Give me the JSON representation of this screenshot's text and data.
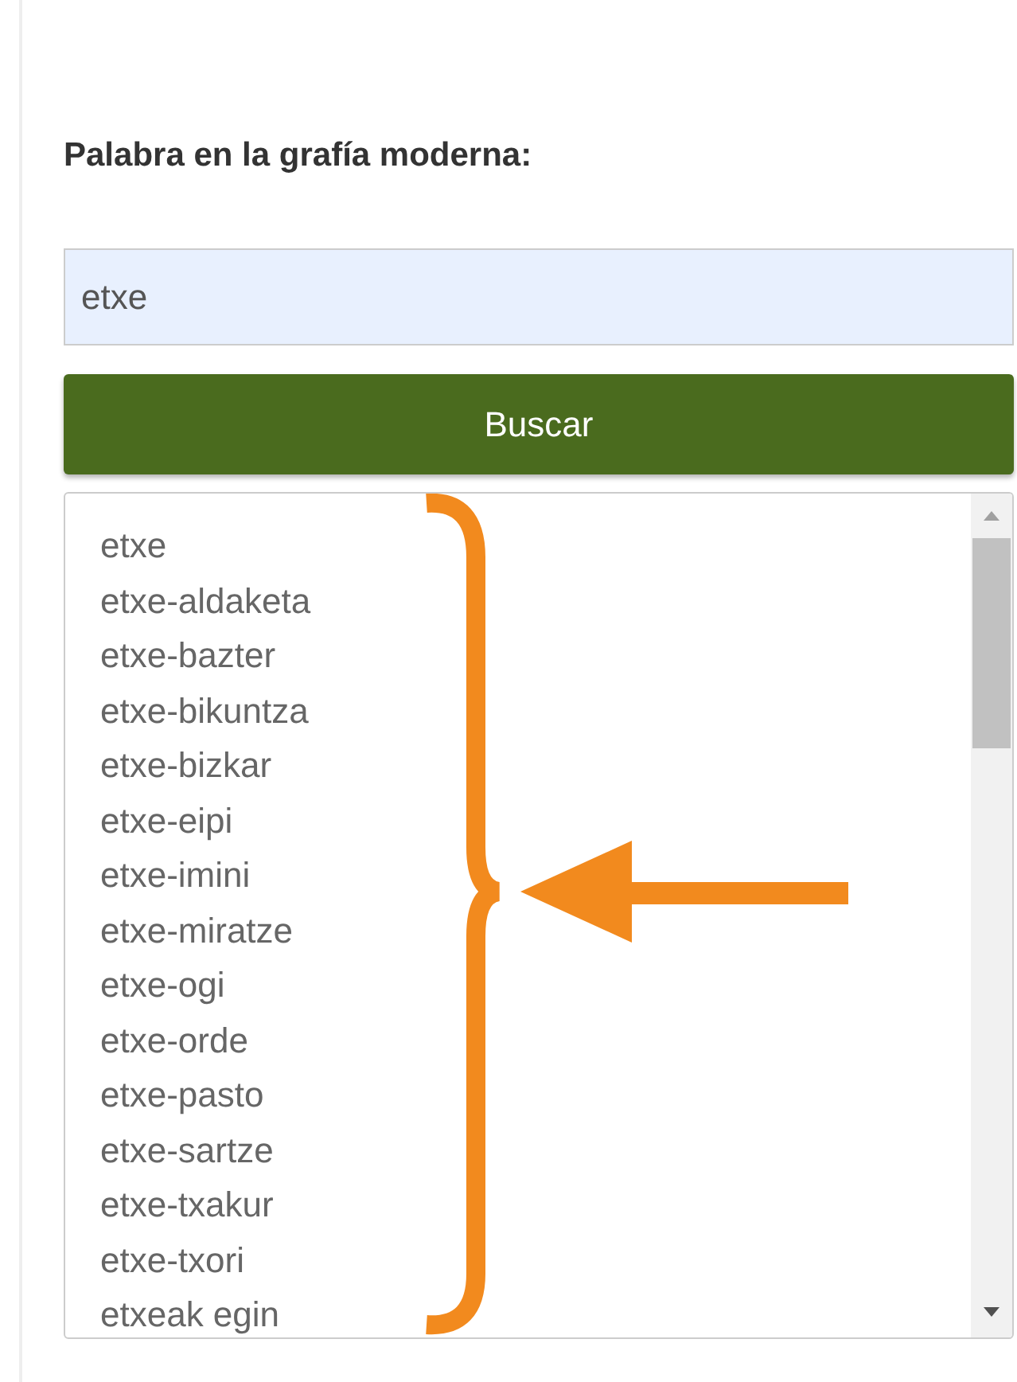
{
  "label": "Palabra en la grafía moderna:",
  "search": {
    "value": "etxe"
  },
  "button": "Buscar",
  "results": [
    "etxe",
    "etxe-aldaketa",
    "etxe-bazter",
    "etxe-bikuntza",
    "etxe-bizkar",
    "etxe-eipi",
    "etxe-imini",
    "etxe-miratze",
    "etxe-ogi",
    "etxe-orde",
    "etxe-pasto",
    "etxe-sartze",
    "etxe-txakur",
    "etxe-txori",
    "etxeak egin"
  ]
}
